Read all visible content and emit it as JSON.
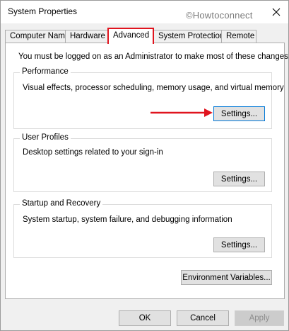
{
  "window": {
    "title": "System Properties",
    "watermark": "©Howtoconnect"
  },
  "tabs": [
    {
      "label": "Computer Name",
      "active": false
    },
    {
      "label": "Hardware",
      "active": false
    },
    {
      "label": "Advanced",
      "active": true
    },
    {
      "label": "System Protection",
      "active": false
    },
    {
      "label": "Remote",
      "active": false
    }
  ],
  "advanced": {
    "notice": "You must be logged on as an Administrator to make most of these changes.",
    "performance": {
      "label": "Performance",
      "description": "Visual effects, processor scheduling, memory usage, and virtual memory",
      "button": "Settings..."
    },
    "user_profiles": {
      "label": "User Profiles",
      "description": "Desktop settings related to your sign-in",
      "button": "Settings..."
    },
    "startup_recovery": {
      "label": "Startup and Recovery",
      "description": "System startup, system failure, and debugging information",
      "button": "Settings..."
    },
    "env_button": "Environment Variables..."
  },
  "footer": {
    "ok": "OK",
    "cancel": "Cancel",
    "apply": "Apply"
  },
  "colors": {
    "highlight": "#e0141e",
    "focus": "#0078d7",
    "dialog_bg": "#f0f0f0"
  }
}
